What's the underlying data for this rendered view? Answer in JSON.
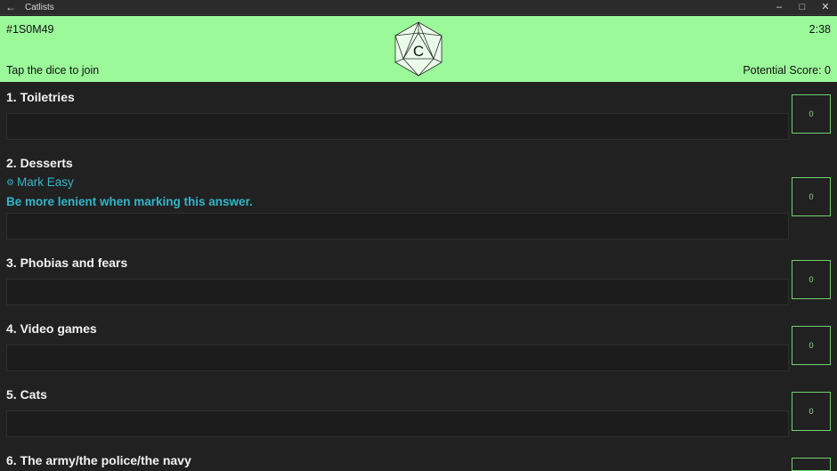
{
  "window": {
    "title": "Catlists",
    "back_glyph": "←",
    "min_glyph": "–",
    "max_glyph": "□",
    "close_glyph": "✕"
  },
  "header": {
    "game_code": "#1S0M49",
    "timer": "2:38",
    "join_prompt": "Tap the dice to join",
    "score_label": "Potential Score:",
    "score_value": "0",
    "dice_letter": "C",
    "bg_color": "#9bf99a"
  },
  "categories": [
    {
      "title": "1. Toiletries",
      "score": "0"
    },
    {
      "title": "2. Desserts",
      "score": "0",
      "mark_easy": "Mark Easy",
      "mark_easy_icon": "gear-icon",
      "note": "Be more lenient when marking this answer."
    },
    {
      "title": "3. Phobias and fears",
      "score": "0"
    },
    {
      "title": "4. Video games",
      "score": "0"
    },
    {
      "title": "5. Cats",
      "score": "0"
    },
    {
      "title": "6. The army/the police/the navy",
      "score": ""
    }
  ],
  "colors": {
    "accent": "#31b6c8",
    "score_border": "#6fd16e",
    "background": "#212121"
  }
}
